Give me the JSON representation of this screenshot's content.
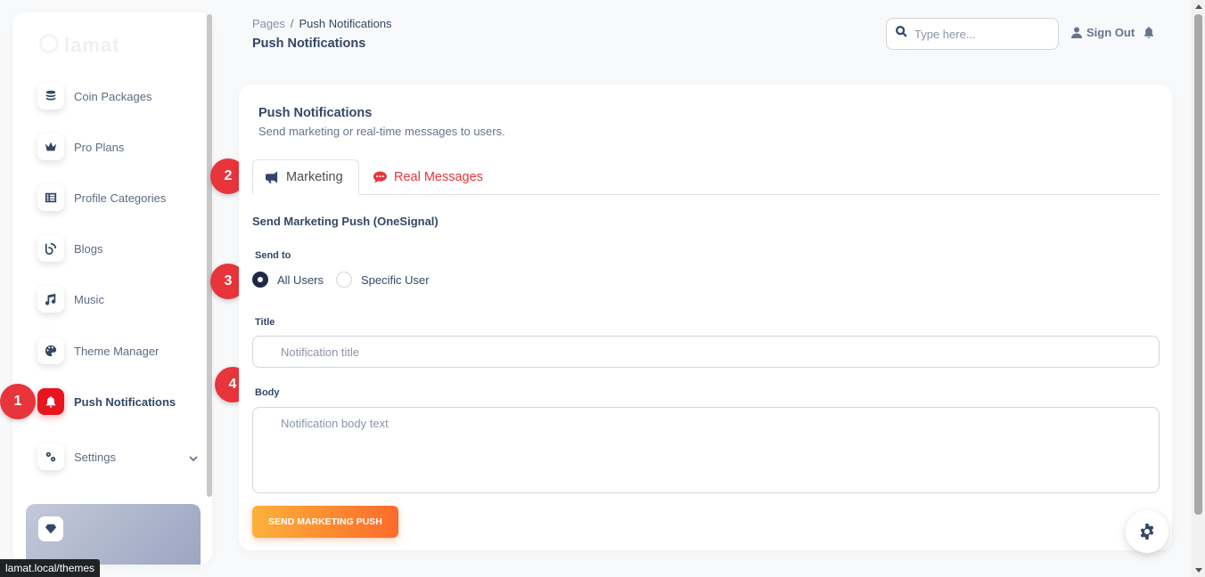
{
  "sidebar": {
    "logo": "lamat",
    "items": [
      {
        "label": "Coin Packages",
        "icon": "coins-icon"
      },
      {
        "label": "Pro Plans",
        "icon": "crown-icon"
      },
      {
        "label": "Profile Categories",
        "icon": "list-icon"
      },
      {
        "label": "Blogs",
        "icon": "blog-icon"
      },
      {
        "label": "Music",
        "icon": "music-icon"
      },
      {
        "label": "Theme Manager",
        "icon": "palette-icon"
      },
      {
        "label": "Push Notifications",
        "icon": "bell-icon",
        "active": true
      },
      {
        "label": "Settings",
        "icon": "gears-icon",
        "expandable": true
      }
    ]
  },
  "steps": [
    "1",
    "2",
    "3",
    "4"
  ],
  "header": {
    "breadcrumb_root": "Pages",
    "breadcrumb_sep": "/",
    "breadcrumb_current": "Push Notifications",
    "title": "Push Notifications",
    "search_placeholder": "Type here...",
    "sign_out": "Sign Out"
  },
  "card": {
    "title": "Push Notifications",
    "subtitle": "Send marketing or real-time messages to users.",
    "tabs": [
      {
        "label": "Marketing",
        "active": true
      },
      {
        "label": "Real Messages",
        "active": false
      }
    ],
    "section_title": "Send Marketing Push (OneSignal)",
    "send_to_label": "Send to",
    "radio_options": [
      {
        "label": "All Users",
        "checked": true
      },
      {
        "label": "Specific User",
        "checked": false
      }
    ],
    "title_label": "Title",
    "title_placeholder": "Notification title",
    "body_label": "Body",
    "body_placeholder": "Notification body text",
    "submit_label": "SEND MARKETING PUSH"
  },
  "status_url": "lamat.local/themes",
  "colors": {
    "accent": "#e8343b",
    "active_icon": "#e8141e",
    "text": "#344767",
    "button_start": "#fbb13a",
    "button_end": "#fd6a2a"
  }
}
